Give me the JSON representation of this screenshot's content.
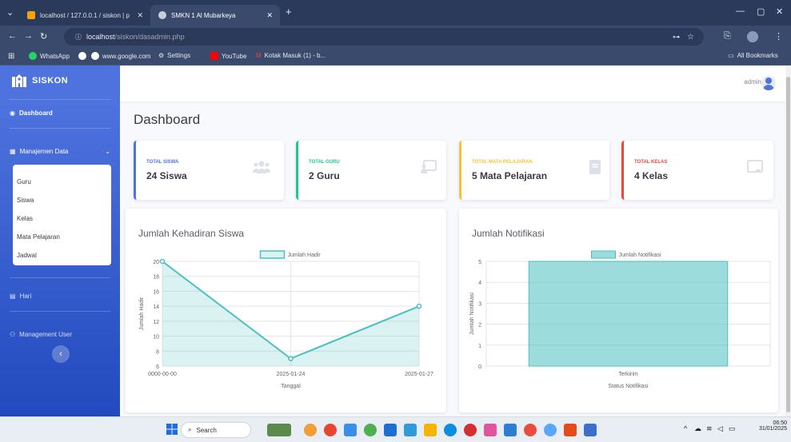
{
  "browser": {
    "tabs": [
      {
        "title": "localhost / 127.0.0.1 / siskon | p"
      },
      {
        "title": "SMKN 1 Al Mubarkeya"
      }
    ],
    "url_host": "localhost",
    "url_path": "/siskon/dasadmin.php",
    "bookmarks": [
      "WhatsApp",
      "www.google.com",
      "Settings",
      "YouTube",
      "Kotak Masuk (1) - b..."
    ],
    "all_bookmarks": "All Bookmarks"
  },
  "sidebar": {
    "brand": "SISKON",
    "dashboard": "Dashboard",
    "manajemen": "Manajemen Data",
    "sub_items": [
      "Guru",
      "Siswa",
      "Kelas",
      "Mata Pelajaran",
      "Jadwal"
    ],
    "hari": "Hari",
    "management_user": "Management User"
  },
  "topbar": {
    "user": "admin"
  },
  "page_title": "Dashboard",
  "stats": [
    {
      "label": "TOTAL SISWA",
      "value": "24 Siswa",
      "color": "#4e73df",
      "icon": "users-icon"
    },
    {
      "label": "TOTAL GURU",
      "value": "2 Guru",
      "color": "#1cc88a",
      "icon": "chalkboard-icon"
    },
    {
      "label": "TOTAL MATA PELAJARAN",
      "value": "5 Mata Pelajaran",
      "color": "#f6c23e",
      "icon": "book-icon"
    },
    {
      "label": "TOTAL KELAS",
      "value": "4 Kelas",
      "color": "#e74a3b",
      "icon": "classroom-icon"
    }
  ],
  "panels": {
    "kehadiran_title": "Jumlah Kehadiran Siswa",
    "notifikasi_title": "Jumlah Notifikasi"
  },
  "chart_data": [
    {
      "type": "line",
      "title": "",
      "x": [
        "0000-00-00",
        "2025-01-24",
        "2025-01-27"
      ],
      "series": [
        {
          "name": "Jumlah Hadir",
          "values": [
            20,
            7,
            14
          ]
        }
      ],
      "xlabel": "Tanggal",
      "ylabel": "Jumlah Hadir",
      "ylim": [
        6,
        20
      ],
      "yticks": [
        6,
        8,
        10,
        12,
        14,
        16,
        18,
        20
      ],
      "legend": "top",
      "grid": true,
      "color": "#4bc0c0"
    },
    {
      "type": "bar",
      "title": "",
      "categories": [
        "Terkirim"
      ],
      "series": [
        {
          "name": "Jumlah Notifikasi",
          "values": [
            5
          ]
        }
      ],
      "xlabel": "Status Notifikasi",
      "ylabel": "Jumlah Notifikasi",
      "ylim": [
        0,
        5
      ],
      "yticks": [
        0,
        1,
        2,
        3,
        4,
        5
      ],
      "legend": "top",
      "grid": true,
      "color": "#4bc0c0"
    }
  ],
  "taskbar": {
    "search": "Search",
    "time": "06:50",
    "date": "31/01/2025"
  }
}
